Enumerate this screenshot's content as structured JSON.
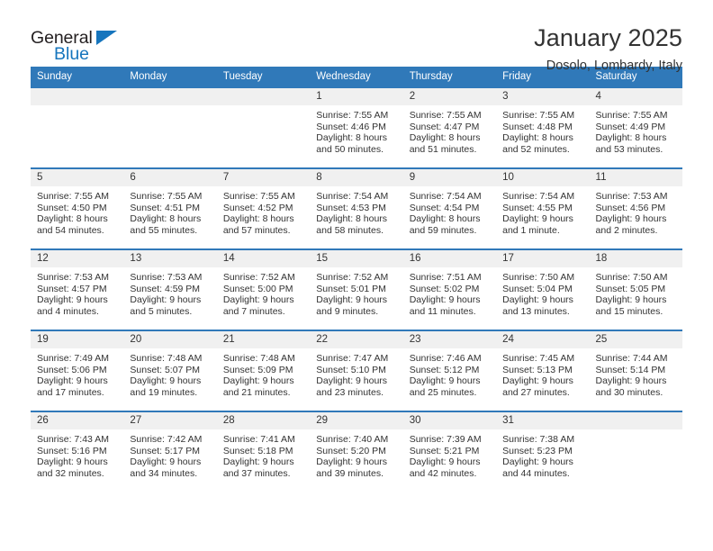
{
  "brand": {
    "line1": "General",
    "line2": "Blue",
    "triangle_color": "#1675bd"
  },
  "header": {
    "month_title": "January 2025",
    "location": "Dosolo, Lombardy, Italy"
  },
  "theme": {
    "header_blue": "#3079b9",
    "daynum_gray": "#f0f0f0",
    "text": "#333333"
  },
  "weekday_headers": [
    "Sunday",
    "Monday",
    "Tuesday",
    "Wednesday",
    "Thursday",
    "Friday",
    "Saturday"
  ],
  "weeks": [
    [
      {
        "day": "",
        "sunrise": "",
        "sunset": "",
        "daylight1": "",
        "daylight2": ""
      },
      {
        "day": "",
        "sunrise": "",
        "sunset": "",
        "daylight1": "",
        "daylight2": ""
      },
      {
        "day": "",
        "sunrise": "",
        "sunset": "",
        "daylight1": "",
        "daylight2": ""
      },
      {
        "day": "1",
        "sunrise": "Sunrise: 7:55 AM",
        "sunset": "Sunset: 4:46 PM",
        "daylight1": "Daylight: 8 hours",
        "daylight2": "and 50 minutes."
      },
      {
        "day": "2",
        "sunrise": "Sunrise: 7:55 AM",
        "sunset": "Sunset: 4:47 PM",
        "daylight1": "Daylight: 8 hours",
        "daylight2": "and 51 minutes."
      },
      {
        "day": "3",
        "sunrise": "Sunrise: 7:55 AM",
        "sunset": "Sunset: 4:48 PM",
        "daylight1": "Daylight: 8 hours",
        "daylight2": "and 52 minutes."
      },
      {
        "day": "4",
        "sunrise": "Sunrise: 7:55 AM",
        "sunset": "Sunset: 4:49 PM",
        "daylight1": "Daylight: 8 hours",
        "daylight2": "and 53 minutes."
      }
    ],
    [
      {
        "day": "5",
        "sunrise": "Sunrise: 7:55 AM",
        "sunset": "Sunset: 4:50 PM",
        "daylight1": "Daylight: 8 hours",
        "daylight2": "and 54 minutes."
      },
      {
        "day": "6",
        "sunrise": "Sunrise: 7:55 AM",
        "sunset": "Sunset: 4:51 PM",
        "daylight1": "Daylight: 8 hours",
        "daylight2": "and 55 minutes."
      },
      {
        "day": "7",
        "sunrise": "Sunrise: 7:55 AM",
        "sunset": "Sunset: 4:52 PM",
        "daylight1": "Daylight: 8 hours",
        "daylight2": "and 57 minutes."
      },
      {
        "day": "8",
        "sunrise": "Sunrise: 7:54 AM",
        "sunset": "Sunset: 4:53 PM",
        "daylight1": "Daylight: 8 hours",
        "daylight2": "and 58 minutes."
      },
      {
        "day": "9",
        "sunrise": "Sunrise: 7:54 AM",
        "sunset": "Sunset: 4:54 PM",
        "daylight1": "Daylight: 8 hours",
        "daylight2": "and 59 minutes."
      },
      {
        "day": "10",
        "sunrise": "Sunrise: 7:54 AM",
        "sunset": "Sunset: 4:55 PM",
        "daylight1": "Daylight: 9 hours",
        "daylight2": "and 1 minute."
      },
      {
        "day": "11",
        "sunrise": "Sunrise: 7:53 AM",
        "sunset": "Sunset: 4:56 PM",
        "daylight1": "Daylight: 9 hours",
        "daylight2": "and 2 minutes."
      }
    ],
    [
      {
        "day": "12",
        "sunrise": "Sunrise: 7:53 AM",
        "sunset": "Sunset: 4:57 PM",
        "daylight1": "Daylight: 9 hours",
        "daylight2": "and 4 minutes."
      },
      {
        "day": "13",
        "sunrise": "Sunrise: 7:53 AM",
        "sunset": "Sunset: 4:59 PM",
        "daylight1": "Daylight: 9 hours",
        "daylight2": "and 5 minutes."
      },
      {
        "day": "14",
        "sunrise": "Sunrise: 7:52 AM",
        "sunset": "Sunset: 5:00 PM",
        "daylight1": "Daylight: 9 hours",
        "daylight2": "and 7 minutes."
      },
      {
        "day": "15",
        "sunrise": "Sunrise: 7:52 AM",
        "sunset": "Sunset: 5:01 PM",
        "daylight1": "Daylight: 9 hours",
        "daylight2": "and 9 minutes."
      },
      {
        "day": "16",
        "sunrise": "Sunrise: 7:51 AM",
        "sunset": "Sunset: 5:02 PM",
        "daylight1": "Daylight: 9 hours",
        "daylight2": "and 11 minutes."
      },
      {
        "day": "17",
        "sunrise": "Sunrise: 7:50 AM",
        "sunset": "Sunset: 5:04 PM",
        "daylight1": "Daylight: 9 hours",
        "daylight2": "and 13 minutes."
      },
      {
        "day": "18",
        "sunrise": "Sunrise: 7:50 AM",
        "sunset": "Sunset: 5:05 PM",
        "daylight1": "Daylight: 9 hours",
        "daylight2": "and 15 minutes."
      }
    ],
    [
      {
        "day": "19",
        "sunrise": "Sunrise: 7:49 AM",
        "sunset": "Sunset: 5:06 PM",
        "daylight1": "Daylight: 9 hours",
        "daylight2": "and 17 minutes."
      },
      {
        "day": "20",
        "sunrise": "Sunrise: 7:48 AM",
        "sunset": "Sunset: 5:07 PM",
        "daylight1": "Daylight: 9 hours",
        "daylight2": "and 19 minutes."
      },
      {
        "day": "21",
        "sunrise": "Sunrise: 7:48 AM",
        "sunset": "Sunset: 5:09 PM",
        "daylight1": "Daylight: 9 hours",
        "daylight2": "and 21 minutes."
      },
      {
        "day": "22",
        "sunrise": "Sunrise: 7:47 AM",
        "sunset": "Sunset: 5:10 PM",
        "daylight1": "Daylight: 9 hours",
        "daylight2": "and 23 minutes."
      },
      {
        "day": "23",
        "sunrise": "Sunrise: 7:46 AM",
        "sunset": "Sunset: 5:12 PM",
        "daylight1": "Daylight: 9 hours",
        "daylight2": "and 25 minutes."
      },
      {
        "day": "24",
        "sunrise": "Sunrise: 7:45 AM",
        "sunset": "Sunset: 5:13 PM",
        "daylight1": "Daylight: 9 hours",
        "daylight2": "and 27 minutes."
      },
      {
        "day": "25",
        "sunrise": "Sunrise: 7:44 AM",
        "sunset": "Sunset: 5:14 PM",
        "daylight1": "Daylight: 9 hours",
        "daylight2": "and 30 minutes."
      }
    ],
    [
      {
        "day": "26",
        "sunrise": "Sunrise: 7:43 AM",
        "sunset": "Sunset: 5:16 PM",
        "daylight1": "Daylight: 9 hours",
        "daylight2": "and 32 minutes."
      },
      {
        "day": "27",
        "sunrise": "Sunrise: 7:42 AM",
        "sunset": "Sunset: 5:17 PM",
        "daylight1": "Daylight: 9 hours",
        "daylight2": "and 34 minutes."
      },
      {
        "day": "28",
        "sunrise": "Sunrise: 7:41 AM",
        "sunset": "Sunset: 5:18 PM",
        "daylight1": "Daylight: 9 hours",
        "daylight2": "and 37 minutes."
      },
      {
        "day": "29",
        "sunrise": "Sunrise: 7:40 AM",
        "sunset": "Sunset: 5:20 PM",
        "daylight1": "Daylight: 9 hours",
        "daylight2": "and 39 minutes."
      },
      {
        "day": "30",
        "sunrise": "Sunrise: 7:39 AM",
        "sunset": "Sunset: 5:21 PM",
        "daylight1": "Daylight: 9 hours",
        "daylight2": "and 42 minutes."
      },
      {
        "day": "31",
        "sunrise": "Sunrise: 7:38 AM",
        "sunset": "Sunset: 5:23 PM",
        "daylight1": "Daylight: 9 hours",
        "daylight2": "and 44 minutes."
      },
      {
        "day": "",
        "sunrise": "",
        "sunset": "",
        "daylight1": "",
        "daylight2": ""
      }
    ]
  ]
}
